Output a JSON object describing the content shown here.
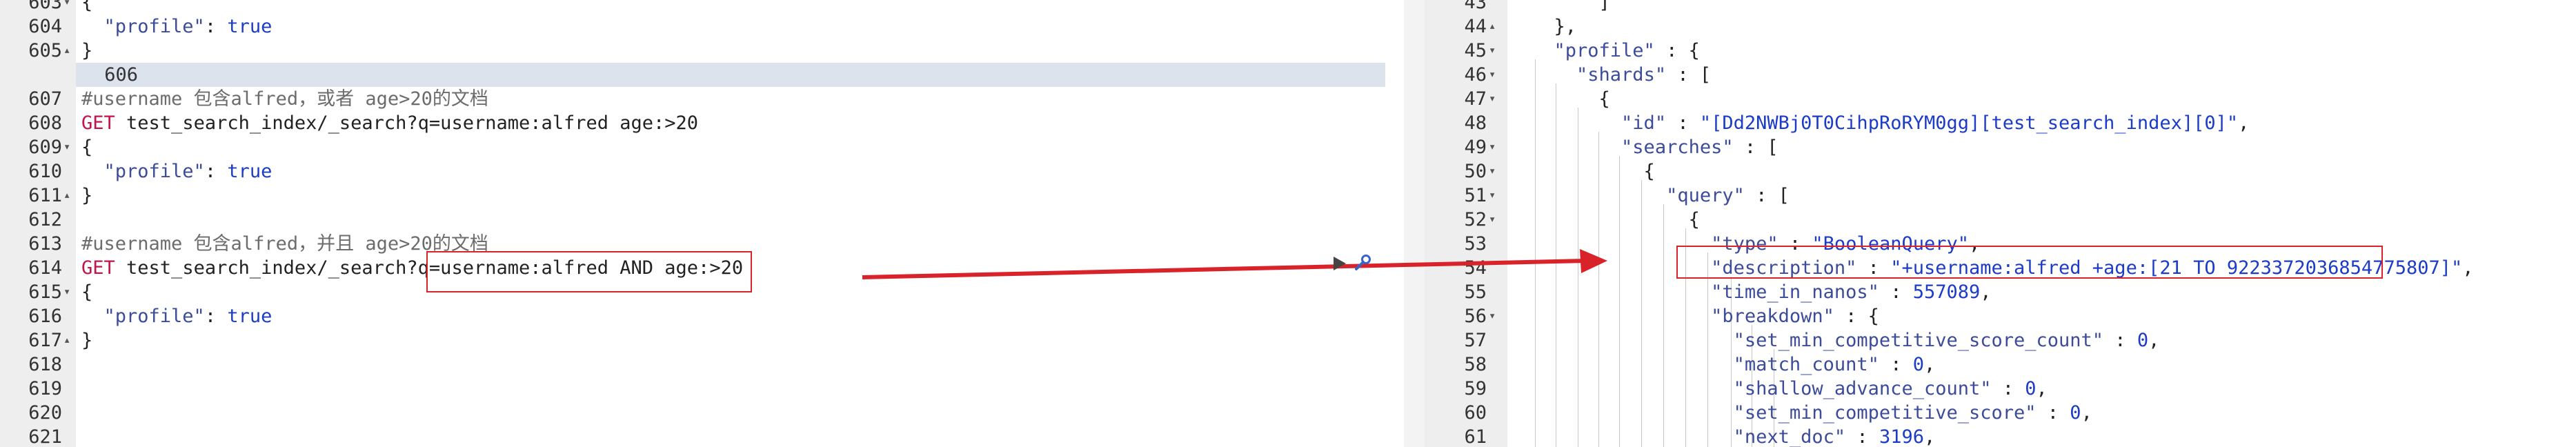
{
  "left_editor": {
    "lines": [
      {
        "n": "603",
        "f": "▾",
        "t": "{"
      },
      {
        "n": "604",
        "f": "",
        "t": "  \"profile\": true"
      },
      {
        "n": "605",
        "f": "▴",
        "t": "}"
      },
      {
        "n": "606",
        "f": "",
        "t": ""
      },
      {
        "n": "607",
        "f": "",
        "t": "#username 包含alfred，或者 age>20的文档"
      },
      {
        "n": "608",
        "f": "",
        "t": "GET test_search_index/_search?q=username:alfred age:>20"
      },
      {
        "n": "609",
        "f": "▾",
        "t": "{"
      },
      {
        "n": "610",
        "f": "",
        "t": "  \"profile\": true"
      },
      {
        "n": "611",
        "f": "▴",
        "t": "}"
      },
      {
        "n": "612",
        "f": "",
        "t": ""
      },
      {
        "n": "613",
        "f": "",
        "t": "#username 包含alfred，并且 age>20的文档"
      },
      {
        "n": "614",
        "f": "",
        "t": "GET test_search_index/_search?q=username:alfred AND age:>20"
      },
      {
        "n": "615",
        "f": "▾",
        "t": "{"
      },
      {
        "n": "616",
        "f": "",
        "t": "  \"profile\": true"
      },
      {
        "n": "617",
        "f": "▴",
        "t": "}"
      },
      {
        "n": "618",
        "f": "",
        "t": ""
      },
      {
        "n": "619",
        "f": "",
        "t": ""
      },
      {
        "n": "620",
        "f": "",
        "t": ""
      },
      {
        "n": "621",
        "f": "",
        "t": ""
      }
    ]
  },
  "right_editor": {
    "lines": [
      {
        "n": "43",
        "f": "",
        "t": "      ]"
      },
      {
        "n": "44",
        "f": "▴",
        "t": "  },"
      },
      {
        "n": "45",
        "f": "▾",
        "t": "  \"profile\" : {"
      },
      {
        "n": "46",
        "f": "▾",
        "t": "    \"shards\" : ["
      },
      {
        "n": "47",
        "f": "▾",
        "t": "      {"
      },
      {
        "n": "48",
        "f": "",
        "t": "        \"id\" : \"[Dd2NWBj0T0CihpRoRYM0gg][test_search_index][0]\","
      },
      {
        "n": "49",
        "f": "▾",
        "t": "        \"searches\" : ["
      },
      {
        "n": "50",
        "f": "▾",
        "t": "          {"
      },
      {
        "n": "51",
        "f": "▾",
        "t": "            \"query\" : ["
      },
      {
        "n": "52",
        "f": "▾",
        "t": "              {"
      },
      {
        "n": "53",
        "f": "",
        "t": "                \"type\" : \"BooleanQuery\","
      },
      {
        "n": "54",
        "f": "",
        "t": "                \"description\" : \"+username:alfred +age:[21 TO 9223372036854775807]\","
      },
      {
        "n": "55",
        "f": "",
        "t": "                \"time_in_nanos\" : 557089,"
      },
      {
        "n": "56",
        "f": "▾",
        "t": "                \"breakdown\" : {"
      },
      {
        "n": "57",
        "f": "",
        "t": "                  \"set_min_competitive_score_count\" : 0,"
      },
      {
        "n": "58",
        "f": "",
        "t": "                  \"match_count\" : 0,"
      },
      {
        "n": "59",
        "f": "",
        "t": "                  \"shallow_advance_count\" : 0,"
      },
      {
        "n": "60",
        "f": "",
        "t": "                  \"set_min_competitive_score\" : 0,"
      },
      {
        "n": "61",
        "f": "",
        "t": "                  \"next_doc\" : 3196,"
      }
    ]
  },
  "colors": {
    "key": "#3c4b9a",
    "value": "#1c3cc8",
    "method": "#c4144a",
    "comment": "#6c6c6c",
    "annotation": "#d9232a",
    "highlight": "#dde3ec"
  },
  "icons": [
    "play-icon",
    "wrench-icon"
  ]
}
